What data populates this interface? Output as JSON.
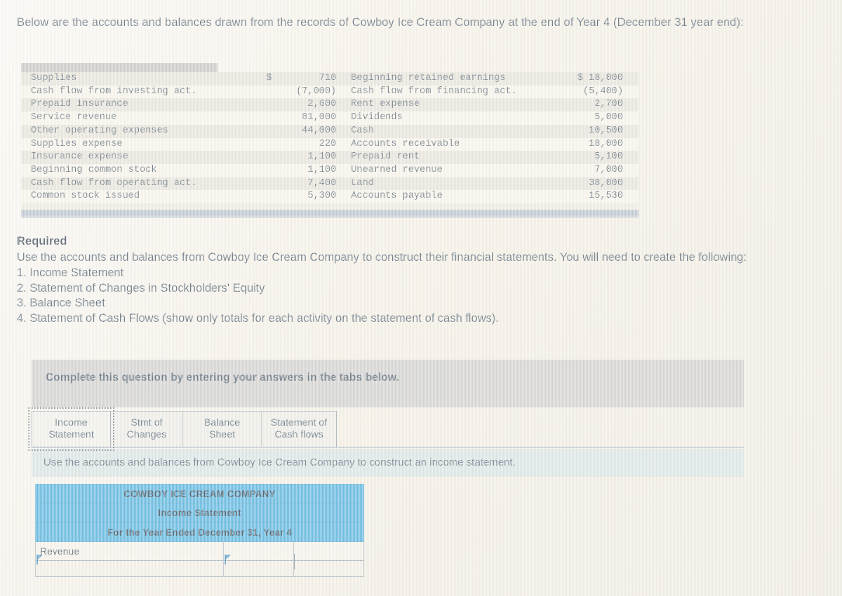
{
  "intro": {
    "text": "Below are the accounts and balances drawn from the records of Cowboy Ice Cream Company at the end of Year 4 (December 31 year end):"
  },
  "accounts_table": {
    "rows": [
      {
        "left_name": "Supplies",
        "left_currency": "$",
        "left_value": "710",
        "right_name": "Beginning retained earnings",
        "right_value": "$ 18,000"
      },
      {
        "left_name": "Cash flow from investing act.",
        "left_currency": "",
        "left_value": "(7,000)",
        "right_name": "Cash flow from financing act.",
        "right_value": "(5,400)"
      },
      {
        "left_name": "Prepaid insurance",
        "left_currency": "",
        "left_value": "2,600",
        "right_name": "Rent expense",
        "right_value": "2,700"
      },
      {
        "left_name": "Service revenue",
        "left_currency": "",
        "left_value": "81,000",
        "right_name": "Dividends",
        "right_value": "5,000"
      },
      {
        "left_name": "Other operating expenses",
        "left_currency": "",
        "left_value": "44,000",
        "right_name": "Cash",
        "right_value": "10,500"
      },
      {
        "left_name": "Supplies expense",
        "left_currency": "",
        "left_value": "220",
        "right_name": "Accounts receivable",
        "right_value": "18,000"
      },
      {
        "left_name": "Insurance expense",
        "left_currency": "",
        "left_value": "1,100",
        "right_name": "Prepaid rent",
        "right_value": "5,100"
      },
      {
        "left_name": "Beginning common stock",
        "left_currency": "",
        "left_value": "1,100",
        "right_name": "Unearned revenue",
        "right_value": "7,000"
      },
      {
        "left_name": "Cash flow from operating act.",
        "left_currency": "",
        "left_value": "7,400",
        "right_name": "Land",
        "right_value": "38,000"
      },
      {
        "left_name": "Common stock issued",
        "left_currency": "",
        "left_value": "5,300",
        "right_name": "Accounts payable",
        "right_value": "15,530"
      }
    ]
  },
  "required": {
    "title": "Required",
    "lead": "Use the accounts and balances from Cowboy Ice Cream Company to construct their financial statements.  You will need to create the following:",
    "items": [
      "1.  Income Statement",
      "2.  Statement of Changes in Stockholders' Equity",
      "3.  Balance Sheet",
      "4.  Statement of Cash Flows (show only totals for each activity on the statement of cash flows)."
    ]
  },
  "complete_banner": {
    "text": "Complete this question by entering your answers in the tabs below."
  },
  "tabs": {
    "items": [
      {
        "label": "Income\nStatement",
        "active": true
      },
      {
        "label": "Stmt of\nChanges",
        "active": false
      },
      {
        "label": "Balance Sheet",
        "active": false
      },
      {
        "label": "Statement of\nCash flows",
        "active": false
      }
    ]
  },
  "instruction": {
    "text": "Use the accounts and balances from Cowboy Ice Cream Company to construct an income statement."
  },
  "income_statement": {
    "company": "COWBOY ICE CREAM COMPANY",
    "title": "Income Statement",
    "period": "For the Year Ended December 31, Year 4",
    "first_row_label": "Revenue",
    "blank": ""
  },
  "colors": {
    "page_bg": "#f3efe6",
    "text": "#73808c",
    "banner_gray": "#d6d5d3",
    "instr_band": "#dde7e7",
    "is_header_blue": "#72bfe2",
    "caret_blue": "#6fa8c9",
    "table_stripe": "#d6d4ce"
  }
}
